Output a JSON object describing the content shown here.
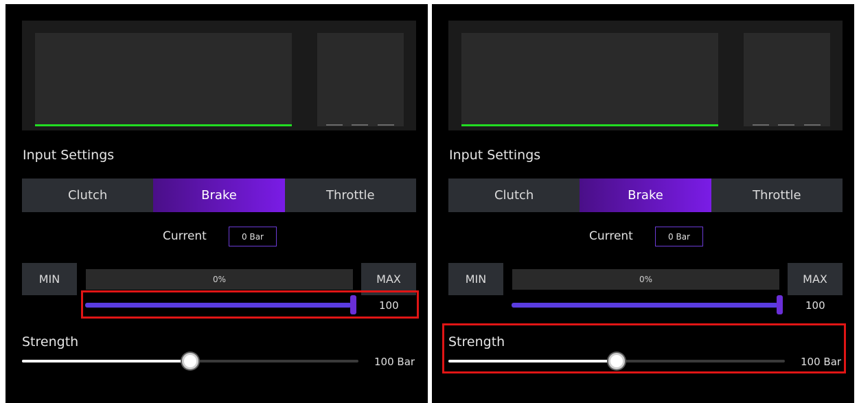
{
  "panels": [
    {
      "id": "left",
      "section_title": "Input Settings",
      "tabs": [
        {
          "label": "Clutch",
          "active": false
        },
        {
          "label": "Brake",
          "active": true
        },
        {
          "label": "Throttle",
          "active": false
        }
      ],
      "current": {
        "label": "Current",
        "value": "0 Bar"
      },
      "min_label": "MIN",
      "max_label": "MAX",
      "percent_text": "0%",
      "range_value": "100",
      "range_level": 1.0,
      "strength": {
        "label": "Strength",
        "value": "100 Bar",
        "level": 0.5
      },
      "highlighted": "range-slider"
    },
    {
      "id": "right",
      "section_title": "Input Settings",
      "tabs": [
        {
          "label": "Clutch",
          "active": false
        },
        {
          "label": "Brake",
          "active": true
        },
        {
          "label": "Throttle",
          "active": false
        }
      ],
      "current": {
        "label": "Current",
        "value": "0 Bar"
      },
      "min_label": "MIN",
      "max_label": "MAX",
      "percent_text": "0%",
      "range_value": "100",
      "range_level": 1.0,
      "strength": {
        "label": "Strength",
        "value": "100 Bar",
        "level": 0.5
      },
      "highlighted": "strength-slider"
    }
  ],
  "colors": {
    "graph_line": "#22dd22",
    "accent": "#7a1ce6",
    "highlight": "#e01515"
  }
}
